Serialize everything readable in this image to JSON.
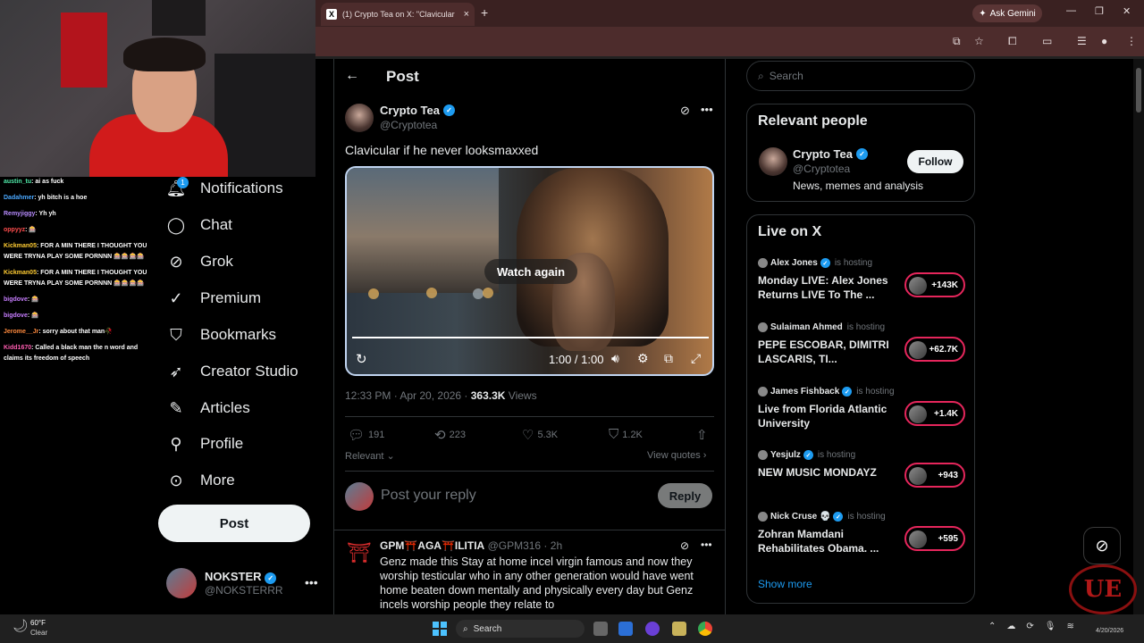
{
  "browser": {
    "tab_title": "(1) Crypto Tea on X: \"Clavicular",
    "tab_close": "×",
    "new_tab": "+",
    "ask_gemini": "Ask Gemini"
  },
  "chat": [
    {
      "user": "austin_tu",
      "color": "#4fe8a8",
      "text": ": ai as fuck"
    },
    {
      "user": "Dadahmer",
      "color": "#4aa8ff",
      "text": ": yh bitch is a hoe"
    },
    {
      "user": "Remyjiggy",
      "color": "#b88cff",
      "text": ": Yh yh"
    },
    {
      "user": "oppyyz",
      "color": "#ff4d4d",
      "text": ": 🎰"
    },
    {
      "user": "Kickman05",
      "color": "#ffcc33",
      "text": ": FOR A MIN THERE I THOUGHT YOU WERE TRYNA PLAY SOME PORNNN 🎰🎰🎰🎰"
    },
    {
      "user": "Kickman05",
      "color": "#ffcc33",
      "text": ": FOR A MIN THERE I THOUGHT YOU WERE TRYNA PLAY SOME PORNNN 🎰🎰🎰🎰"
    },
    {
      "user": "bigdove",
      "color": "#c77dff",
      "text": ": 🎰"
    },
    {
      "user": "bigdove",
      "color": "#c77dff",
      "text": ": 🎰"
    },
    {
      "user": "Jerome__Jr",
      "color": "#ff8a3d",
      "text": ": sorry about that man🥀"
    },
    {
      "user": "Kidd1670",
      "color": "#ff5db1",
      "text": ": Called a black man the n word and claims its freedom of speech"
    }
  ],
  "nav": {
    "notifications": "Notifications",
    "notif_count": "1",
    "chat": "Chat",
    "grok": "Grok",
    "premium": "Premium",
    "bookmarks": "Bookmarks",
    "creator_studio": "Creator Studio",
    "articles": "Articles",
    "profile": "Profile",
    "more": "More",
    "post_button": "Post"
  },
  "account": {
    "name": "NOKSTER",
    "handle": "@NOKSTERRR"
  },
  "post": {
    "header": "Post",
    "author_name": "Crypto Tea",
    "author_handle": "@Cryptotea",
    "text": "Clavicular if he never looksmaxxed",
    "video": {
      "overlay": "Watch again",
      "time": "1:00 / 1:00",
      "progress": 1.0
    },
    "timestamp": "12:33 PM · Apr 20, 2026 · ",
    "views_count": "363.3K",
    "views_label": " Views",
    "replies": "191",
    "reposts": "223",
    "likes": "5.3K",
    "bookmarks": "1.2K",
    "sort_label": "Relevant ⌄",
    "view_quotes": "View quotes ›",
    "reply_placeholder": "Post your reply",
    "reply_button": "Reply"
  },
  "reply": {
    "name": "GPM⛩️AGA⛩️ILITIA",
    "handle": "@GPM316 · 2h",
    "text": "Genz made this Stay at home incel virgin famous and now they worship testicular who in any other generation would have went home beaten down mentally and physically every day but Genz incels worship people they relate to"
  },
  "sidebar": {
    "search_placeholder": "Search",
    "relevant_title": "Relevant people",
    "relevant_name": "Crypto Tea",
    "relevant_handle": "@Cryptotea",
    "relevant_bio": "News, memes and analysis",
    "follow_button": "Follow",
    "live_title": "Live on X",
    "live": [
      {
        "host": "Alex Jones",
        "verified": true,
        "title": "Monday LIVE: Alex Jones Returns LIVE To The ...",
        "count": "+143K"
      },
      {
        "host": "Sulaiman Ahmed",
        "verified": false,
        "title": "PEPE ESCOBAR, DIMITRI LASCARIS, TI...",
        "count": "+62.7K"
      },
      {
        "host": "James Fishback",
        "verified": true,
        "title": "Live from Florida Atlantic University",
        "count": "+1.4K"
      },
      {
        "host": "Yesjulz",
        "verified": true,
        "title": "NEW MUSIC MONDAYZ",
        "count": "+943"
      },
      {
        "host": "Nick Cruse 💀",
        "verified": true,
        "title": "Zohran Mamdani Rehabilitates Obama. ...",
        "count": "+595"
      }
    ],
    "is_hosting": "is hosting",
    "show_more": "Show more"
  },
  "taskbar": {
    "temp": "60°F",
    "condition": "Clear",
    "search": "Search",
    "date": "4/20/2026"
  },
  "overlay_logo": "UE"
}
